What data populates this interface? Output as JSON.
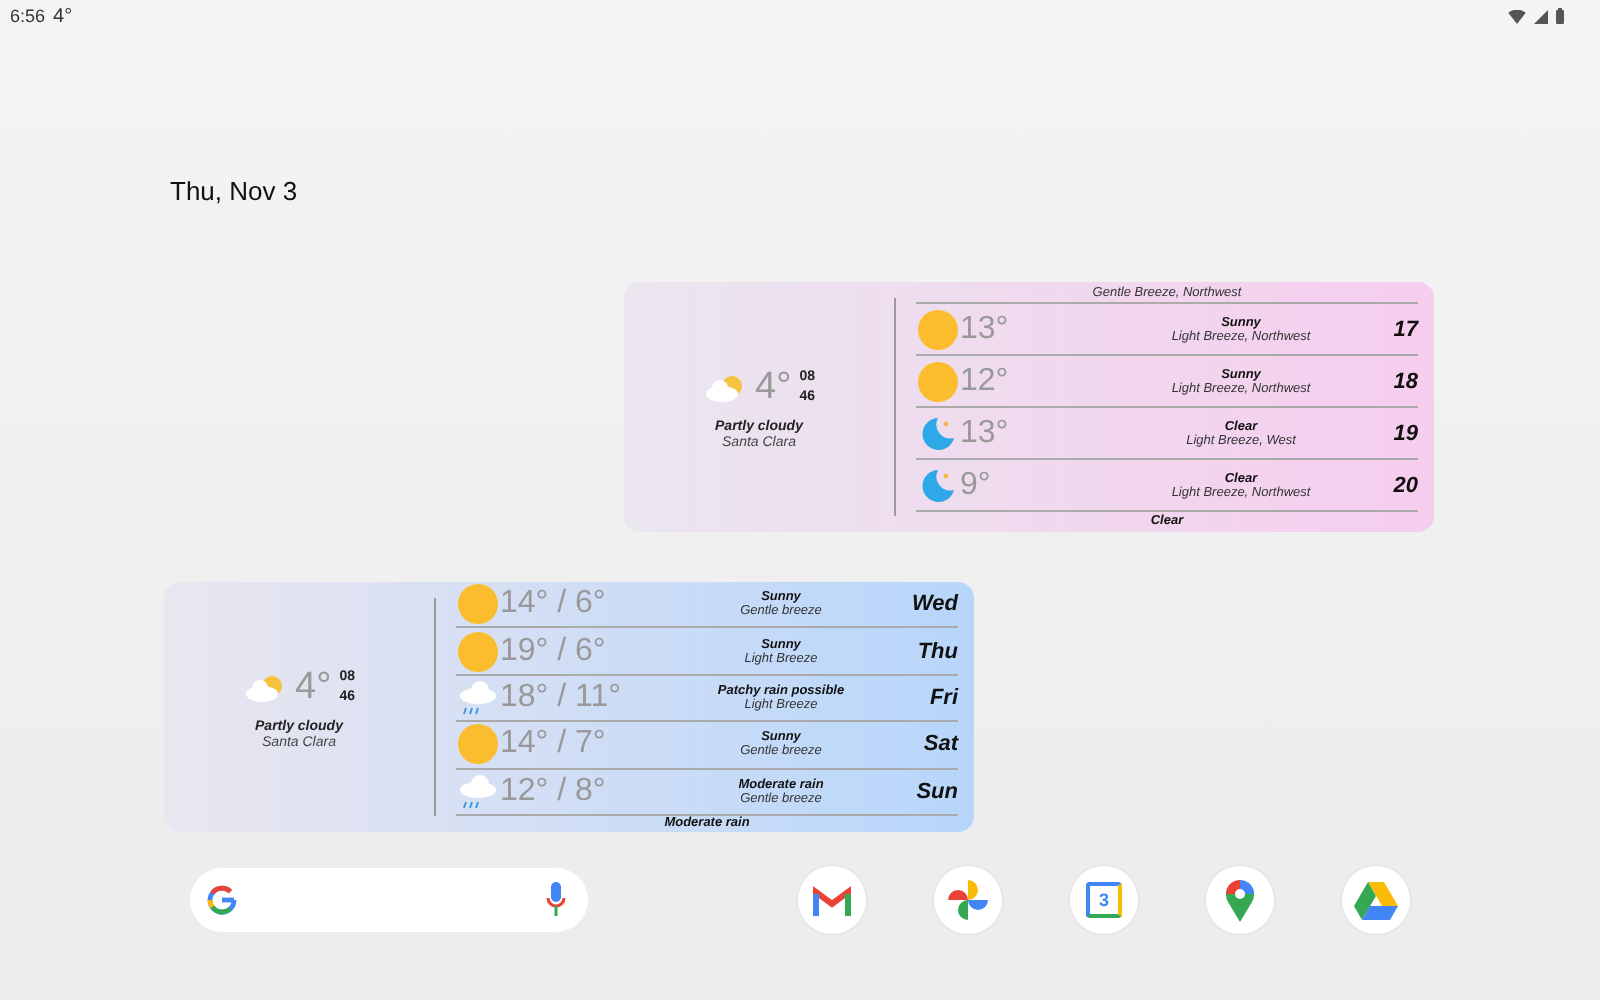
{
  "status_bar": {
    "time": "6:56",
    "temperature": "4°"
  },
  "date": "Thu, Nov 3",
  "widgets": [
    {
      "color": "#f6cdee",
      "current": {
        "temperature": "4°",
        "hour": "08",
        "minute": "46",
        "condition": "Partly cloudy",
        "location": "Santa Clara"
      },
      "rows": [
        {
          "kind": "partial",
          "wind": "Gentle Breeze, Northwest"
        },
        {
          "kind": "sun",
          "temperature": "13°",
          "condition": "Sunny",
          "wind": "Light Breeze, Northwest",
          "label": "17"
        },
        {
          "kind": "sun",
          "temperature": "12°",
          "condition": "Sunny",
          "wind": "Light Breeze, Northwest",
          "label": "18"
        },
        {
          "kind": "moon",
          "temperature": "13°",
          "condition": "Clear",
          "wind": "Light Breeze, West",
          "label": "19"
        },
        {
          "kind": "moon",
          "temperature": "9°",
          "condition": "Clear",
          "wind": "Light Breeze, Northwest",
          "label": "20"
        },
        {
          "kind": "partial",
          "condition": "Clear"
        }
      ]
    },
    {
      "color": "#b7d6fb",
      "current": {
        "temperature": "4°",
        "hour": "08",
        "minute": "46",
        "condition": "Partly cloudy",
        "location": "Santa Clara"
      },
      "rows": [
        {
          "kind": "sun",
          "temperature": "14° / 6°",
          "condition": "Sunny",
          "wind": "Gentle breeze",
          "label": "Wed"
        },
        {
          "kind": "sun",
          "temperature": "19° / 6°",
          "condition": "Sunny",
          "wind": "Light Breeze",
          "label": "Thu"
        },
        {
          "kind": "rain",
          "temperature": "18° / 11°",
          "condition": "Patchy rain possible",
          "wind": "Light Breeze",
          "label": "Fri"
        },
        {
          "kind": "sun",
          "temperature": "14° / 7°",
          "condition": "Sunny",
          "wind": "Gentle breeze",
          "label": "Sat"
        },
        {
          "kind": "rain",
          "temperature": "12° / 8°",
          "condition": "Moderate rain",
          "wind": "Gentle breeze",
          "label": "Sun"
        },
        {
          "kind": "partial",
          "condition": "Moderate rain"
        }
      ]
    }
  ],
  "dock": [
    {
      "kind": "gmail"
    },
    {
      "kind": "photos"
    },
    {
      "kind": "calendar",
      "text": "3"
    },
    {
      "kind": "maps"
    },
    {
      "kind": "drive"
    }
  ]
}
